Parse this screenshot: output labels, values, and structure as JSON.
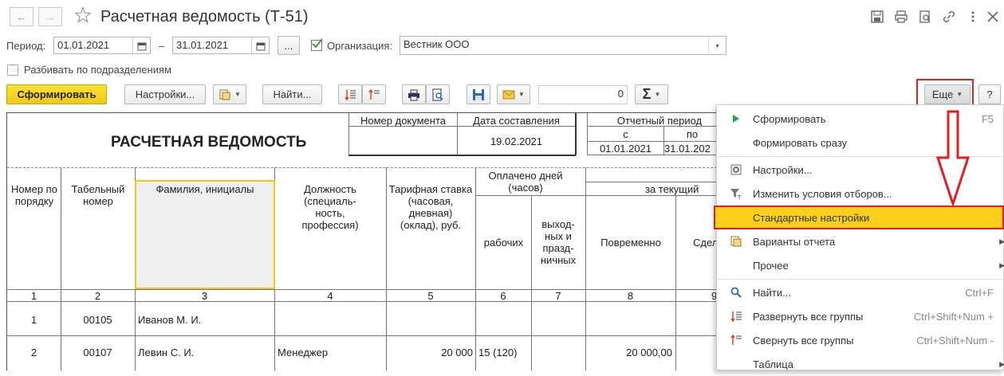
{
  "window": {
    "title": "Расчетная ведомость (Т-51)"
  },
  "filters": {
    "period_label": "Период:",
    "date_from": "01.01.2021",
    "dash": "–",
    "date_to": "31.01.2021",
    "more": "...",
    "org_label": "Организация:",
    "org_value": "Вестник ООО",
    "split_label": "Разбивать по подразделениям"
  },
  "toolbar": {
    "generate": "Сформировать",
    "settings": "Настройки...",
    "find": "Найти...",
    "sum_value": "0",
    "more": "Еще",
    "help": "?"
  },
  "report": {
    "title": "РАСЧЕТНАЯ ВЕДОМОСТЬ",
    "doc_number_header": "Номер документа",
    "date_header": "Дата составления",
    "date_value": "19.02.2021",
    "period_header": "Отчетный период",
    "period_from_label": "с",
    "period_to_label": "по",
    "period_from": "01.01.2021",
    "period_to": "31.01.202",
    "columns": {
      "c1": "Номер по порядку",
      "c2": "Табельный номер",
      "c3": "Фамилия, инициалы",
      "c4": "Должность (специаль-ность, профессия)",
      "c5": "Тарифная ставка (часовая, дневная) (оклад), руб.",
      "paid": "Оплачено дней (часов)",
      "c6": "рабочих",
      "c7": "выход-ных и празд-ничных",
      "current": "за текущий",
      "c8": "Повременно",
      "c9": "Сдел"
    },
    "col_numbers": [
      "1",
      "2",
      "3",
      "4",
      "5",
      "6",
      "7",
      "8",
      "9"
    ],
    "rows": [
      {
        "n": "1",
        "tab": "00105",
        "name": "Иванов М. И.",
        "pos": "",
        "rate": "",
        "days": "",
        "hol": "",
        "time": ""
      },
      {
        "n": "2",
        "tab": "00107",
        "name": "Левин С. И.",
        "pos": "Менеджер",
        "rate": "20 000",
        "days": "15 (120)",
        "hol": "",
        "time": "20 000,00"
      }
    ]
  },
  "menu": {
    "items": [
      {
        "label": "Сформировать",
        "shortcut": "F5",
        "icon": "play-icon"
      },
      {
        "label": "Формировать сразу",
        "shortcut": "",
        "icon": ""
      },
      {
        "label": "Настройки...",
        "shortcut": "",
        "icon": "settings-icon"
      },
      {
        "label": "Изменить условия отборов...",
        "shortcut": "",
        "icon": "filter-icon"
      },
      {
        "label": "Стандартные настройки",
        "shortcut": "",
        "icon": ""
      },
      {
        "label": "Варианты отчета",
        "shortcut": "",
        "icon": "report-variants-icon"
      },
      {
        "label": "Прочее",
        "shortcut": "",
        "icon": ""
      },
      {
        "label": "Найти...",
        "shortcut": "Ctrl+F",
        "icon": "search-icon"
      },
      {
        "label": "Развернуть все группы",
        "shortcut": "Ctrl+Shift+Num +",
        "icon": "expand-icon"
      },
      {
        "label": "Свернуть все группы",
        "shortcut": "Ctrl+Shift+Num -",
        "icon": "collapse-icon"
      },
      {
        "label": "Таблица",
        "shortcut": "",
        "icon": ""
      }
    ]
  },
  "colors": {
    "accent_yellow": "#f9d22a",
    "highlight_red": "#e02020",
    "menu_highlight": "#fbcf1a"
  }
}
